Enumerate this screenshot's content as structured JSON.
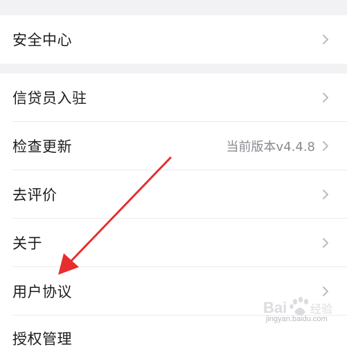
{
  "menu": {
    "security_center": "安全中心",
    "loan_officer_join": "信贷员入驻",
    "check_update": "检查更新",
    "current_version": "当前版本v4.4.8",
    "rate_app": "去评价",
    "about": "关于",
    "user_agreement": "用户协议",
    "permission_management": "授权管理"
  },
  "watermark": {
    "text": "jingyan.baidu.com",
    "logo": "Bai百度经验"
  },
  "colors": {
    "section_gap": "#f2f2f4",
    "arrow": "#e62e2e",
    "chevron": "#b9bbbf"
  },
  "icons": {
    "chevron": "chevron-right-icon"
  }
}
